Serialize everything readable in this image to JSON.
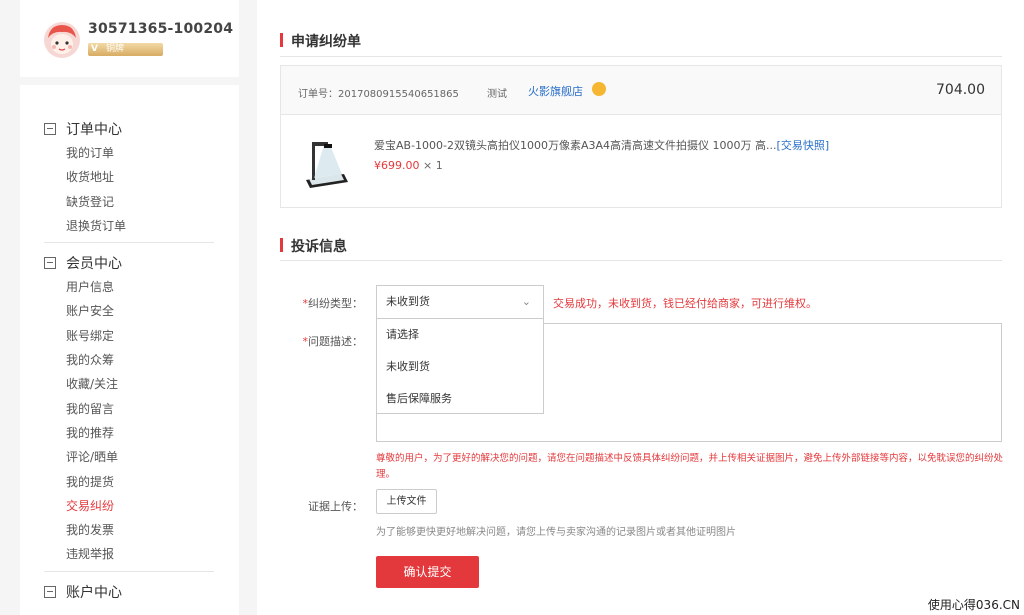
{
  "user": {
    "id": "30571365-100204",
    "badge_v": "V",
    "badge_label": "铜牌"
  },
  "sidebar": {
    "groups": [
      {
        "title": "订单中心",
        "items": [
          "我的订单",
          "收货地址",
          "缺货登记",
          "退换货订单"
        ]
      },
      {
        "title": "会员中心",
        "items": [
          "用户信息",
          "账户安全",
          "账号绑定",
          "我的众筹",
          "收藏/关注",
          "我的留言",
          "我的推荐",
          "评论/晒单",
          "我的提货",
          "交易纠纷",
          "我的发票",
          "违规举报"
        ]
      },
      {
        "title": "账户中心",
        "items": []
      }
    ],
    "active_item": "交易纠纷"
  },
  "sections": {
    "apply_title": "申请纠纷单",
    "complaint_title": "投诉信息"
  },
  "order": {
    "number_label": "订单号：",
    "number": "2017080915540651865",
    "test_label": "测试",
    "store": "火影旗舰店",
    "total": "704.00",
    "product_name": "爱宝AB-1000-2双镜头高拍仪1000万像素A3A4高清高速文件拍摄仪 1000万 高...",
    "snapshot_link": "[交易快照]",
    "price": "¥699.00",
    "quantity": "× 1"
  },
  "form": {
    "required_mark": "*",
    "dispute_type_label": "纠纷类型：",
    "dispute_type_value": "未收到货",
    "dispute_options": [
      "请选择",
      "未收到货",
      "售后保障服务"
    ],
    "dispute_hint": "交易成功，未收到货，钱已经付给商家，可进行维权。",
    "description_label": "问题描述：",
    "warning": "尊敬的用户，为了更好的解决您的问题，请您在问题描述中反馈具体纠纷问题，并上传相关证据图片，避免上传外部链接等内容，以免耽误您的纠纷处理。",
    "evidence_label": "证据上传：",
    "upload_button": "上传文件",
    "upload_hint": "为了能够更快更好地解决问题，请您上传与卖家沟通的记录图片或者其他证明图片",
    "submit_button": "确认提交"
  },
  "watermark": "使用心得036.CN",
  "colors": {
    "accent": "#e4393c",
    "link": "#2a6fc9"
  }
}
